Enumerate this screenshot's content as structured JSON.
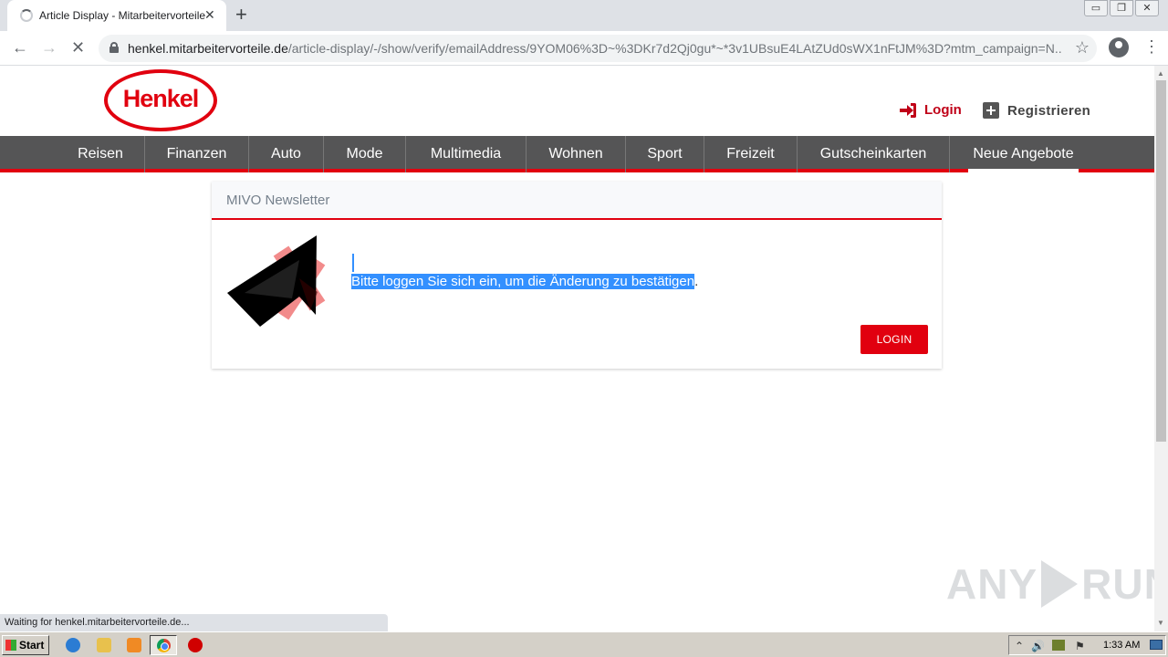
{
  "browser": {
    "tab": {
      "title": "Article Display - Mitarbeitervorteile",
      "close": "✕"
    },
    "new_tab": "+",
    "window_controls": [
      "▭",
      "❐",
      "✕"
    ],
    "url": {
      "host": "henkel.mitarbeitervorteile.de",
      "path": "/article-display/-/show/verify/emailAddress/9YOM06%3D~%3DKr7d2Qj0gu*~*3v1UBsuE4LAtZUd0sWX1nFtJM%3D?mtm_campaign=N..."
    },
    "nav_icons": {
      "back": "←",
      "forward": "→",
      "stop": "✕",
      "star": "☆",
      "menu": "⋮"
    },
    "status": "Waiting for henkel.mitarbeitervorteile.de..."
  },
  "site": {
    "logo": "Henkel",
    "header": {
      "login_label": "Login",
      "register_label": "Registrieren"
    },
    "nav": [
      "Reisen",
      "Finanzen",
      "Auto",
      "Mode",
      "Multimedia",
      "Wohnen",
      "Sport",
      "Freizeit",
      "Gutscheinkarten",
      "Neue Angebote"
    ],
    "active_nav": "Neue Angebote",
    "card": {
      "title": "MIVO Newsletter",
      "message_selected": "Bitte loggen Sie sich ein, um die Änderung zu bestätigen",
      "message_rest": ".",
      "button": "LOGIN"
    },
    "watermark": {
      "left": "ANY",
      "right": "RUN"
    }
  },
  "taskbar": {
    "start": "Start",
    "clock": "1:33 AM",
    "tray_icons": [
      "⌃",
      "🔊",
      "⚑"
    ]
  },
  "colors": {
    "brand_red": "#e1000f",
    "nav_gray": "#555556",
    "selection_blue": "#3390ff"
  }
}
